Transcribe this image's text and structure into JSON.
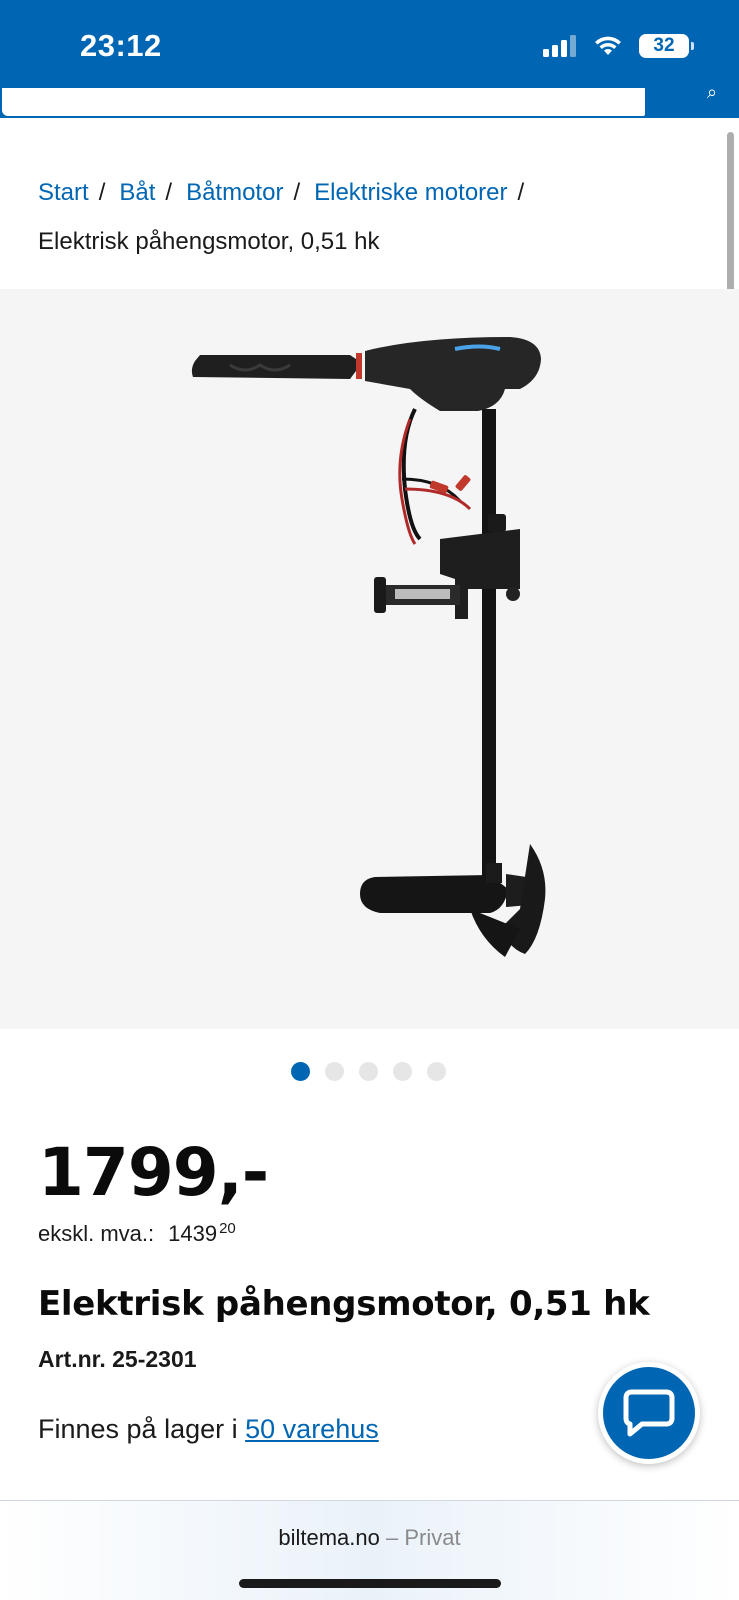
{
  "status_bar": {
    "time": "23:12",
    "battery": "32"
  },
  "breadcrumb": {
    "items": [
      "Start",
      "Båt",
      "Båtmotor",
      "Elektriske motorer"
    ],
    "separator": "/",
    "current": "Elektrisk påhengsmotor, 0,51 hk"
  },
  "gallery": {
    "total_images": 5,
    "active_index": 0
  },
  "product": {
    "price": "1799,-",
    "ex_vat_label": "ekskl. mva.:",
    "ex_vat_whole": "1439",
    "ex_vat_cents": "20",
    "title": "Elektrisk påhengsmotor, 0,51 hk",
    "art_nr": "Art.nr. 25-2301",
    "stock_prefix": "Finnes på lager i",
    "stock_link": "50 varehus"
  },
  "browser": {
    "domain": "biltema.no",
    "mode_separator": "–",
    "mode": "Privat"
  },
  "colors": {
    "brand_blue": "#0066b3",
    "image_bg": "#f5f5f5"
  },
  "icons": [
    "signal-icon",
    "wifi-icon",
    "battery-icon",
    "chat-icon",
    "search-icon"
  ]
}
